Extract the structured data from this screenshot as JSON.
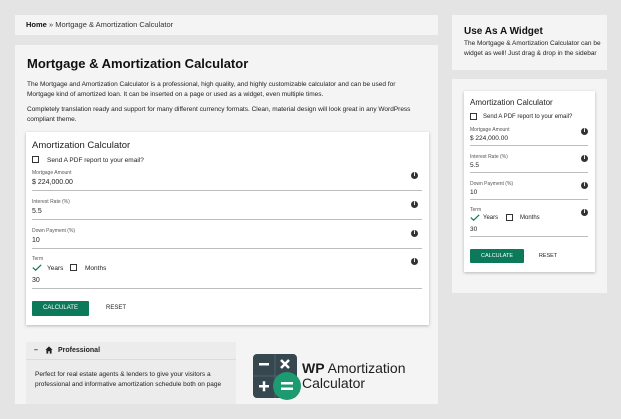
{
  "breadcrumb": {
    "home": "Home",
    "separator": "»",
    "current": "Mortgage & Amortization Calculator"
  },
  "main": {
    "title": "Mortgage & Amortization Calculator",
    "intro": "The Mortgage and Amortization Calculator is a professional, high quality, and highly customizable calculator and can be used for Mortgage kind of amortized loan.  It can be inserted on a page or used as a widget, even multiple times.",
    "intro2": "Completely translation ready and support for many different currency formats.  Clean, material design will look great in any WordPress compliant theme."
  },
  "calculator": {
    "title": "Amortization Calculator",
    "pdf_label": "Send A PDF report to your email?",
    "mortgage_label": "Mortgage Amount",
    "mortgage_value": "$ 224,000.00",
    "rate_label": "Interest Rate (%)",
    "rate_value": "5.5",
    "down_label": "Down Payment (%)",
    "down_value": "10",
    "term_label": "Term",
    "years_label": "Years",
    "months_label": "Months",
    "term_value": "30",
    "calculate_label": "CALCULATE",
    "reset_label": "RESET",
    "info_glyph": "i"
  },
  "widget_promo": {
    "title": "Use As A Widget",
    "text": "The Mortgage & Amortization Calculator can be widget as well! Just drag & drop in the sidebar"
  },
  "pro": {
    "collapse_glyph": "–",
    "title": "Professional",
    "text": "Perfect for real estate agents & lenders to give your visitors a professional and informative amortization schedule both on page"
  },
  "logo": {
    "line1_bold": "WP",
    "line1_rest": " Amortization",
    "line2": "Calculator"
  },
  "colors": {
    "accent": "#0c7a5a",
    "logo_tile": "#37474f",
    "logo_circle": "#1e9a70"
  },
  "icons": [
    "home-icon",
    "info-icon",
    "check-icon",
    "minus-icon",
    "multiply-icon",
    "plus-icon",
    "equals-icon"
  ]
}
